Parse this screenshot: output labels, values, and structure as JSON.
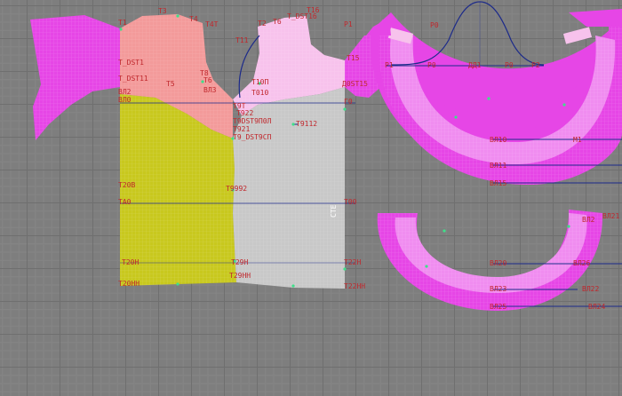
{
  "colors": {
    "magenta": "#e646e6",
    "magenta_light": "#f08cf0",
    "salmon": "#f39a9a",
    "pink_light": "#f7c2ec",
    "yellow": "#c8c81e",
    "gray": "#c8c8c8",
    "label": "#c0282d",
    "line": "#1c2a8a"
  },
  "labels": {
    "t3": "T3",
    "t1": "T1",
    "t4": "T4",
    "t4t": "T4T",
    "t2": "T2",
    "t6": "T6",
    "t16": "T16",
    "t_dst16": "T_DST16",
    "t11": "T11",
    "p1_top": "P1",
    "t15": "T15",
    "t_dst1": "T_DST1",
    "t_dst11": "T_DST11",
    "t5": "T5",
    "t8": "T8",
    "t6b": "T6",
    "vl2": "ВЛ2",
    "vl3": "ВЛ3",
    "t10p": "T10П",
    "t010": "T010",
    "vl0": "ВЛ0",
    "g1": "Г1",
    "g0": "Г0",
    "dstl5": "Д0ST15",
    "t9t": "T9T",
    "t922": "T922",
    "t9dst": "T9DST9П0Л",
    "t921": "T921",
    "t9nn": "T9_DST9СП",
    "t9112": "Т9112",
    "t20b": "T20В",
    "t992": "Т9992",
    "ta0": "TА0",
    "t00": "Т00",
    "t20n": "T20Н",
    "t29n": "T29Н",
    "t22n": "T22Н",
    "t20nn": "T20НН",
    "t29nn": "T29НН",
    "t22nn": "T22НН",
    "ro": "Р0",
    "p1": "P1",
    "ro2": "Р0",
    "dd1": "ДД1",
    "ro3": "Р0",
    "p2": "P2",
    "vl10": "ВЛ10",
    "vl1": "ВЛ1",
    "vl11": "ВЛ11",
    "vl15": "ВЛ15",
    "vl20": "ВЛ20",
    "vl2a": "ВЛ2",
    "vl21": "ВЛ21",
    "vl26": "ВЛ26",
    "vl22": "ВЛ22",
    "vl23": "ВЛ23",
    "vl25": "ВЛ25",
    "vl24": "ВЛ24",
    "vl25b": "ВЛ25",
    "m1": "М1",
    "side_text": "СТЕ"
  }
}
